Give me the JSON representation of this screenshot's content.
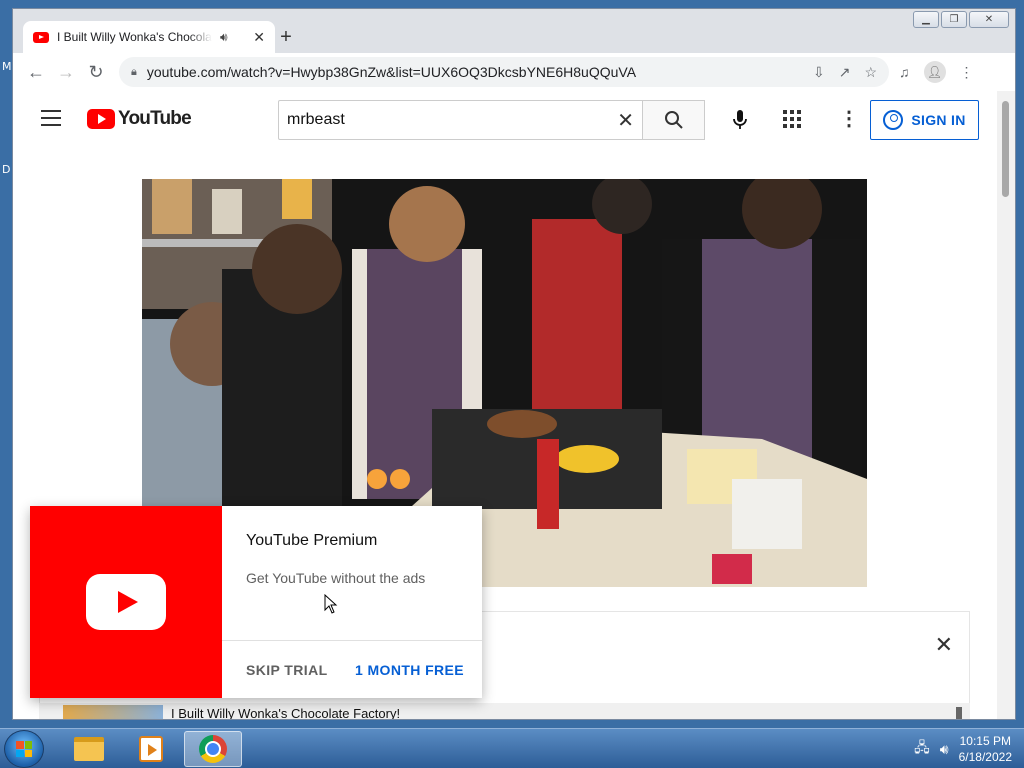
{
  "desktop": {
    "edge_letters": [
      "M",
      "D"
    ]
  },
  "browser": {
    "tab": {
      "title": "I Built Willy Wonka's Chocolate Factory!",
      "audio_icon": "speaker-icon"
    },
    "new_tab_label": "+",
    "url": "youtube.com/watch?v=Hwybp38GnZw&list=UUX6OQ3DkcsbYNE6H8uQQuVA"
  },
  "youtube": {
    "logo_text": "YouTube",
    "search": {
      "value": "mrbeast"
    },
    "signin_label": "SIGN IN",
    "brand_color": "#ff0000",
    "link_color": "#065fd4"
  },
  "playlist": {
    "first_title": "I Built Willy Wonka's Chocolate Factory!"
  },
  "promo": {
    "title": "YouTube Premium",
    "subtitle": "Get YouTube without the ads",
    "skip_label": "SKIP TRIAL",
    "free_label": "1 MONTH FREE"
  },
  "taskbar": {
    "time": "10:15 PM",
    "date": "6/18/2022"
  }
}
